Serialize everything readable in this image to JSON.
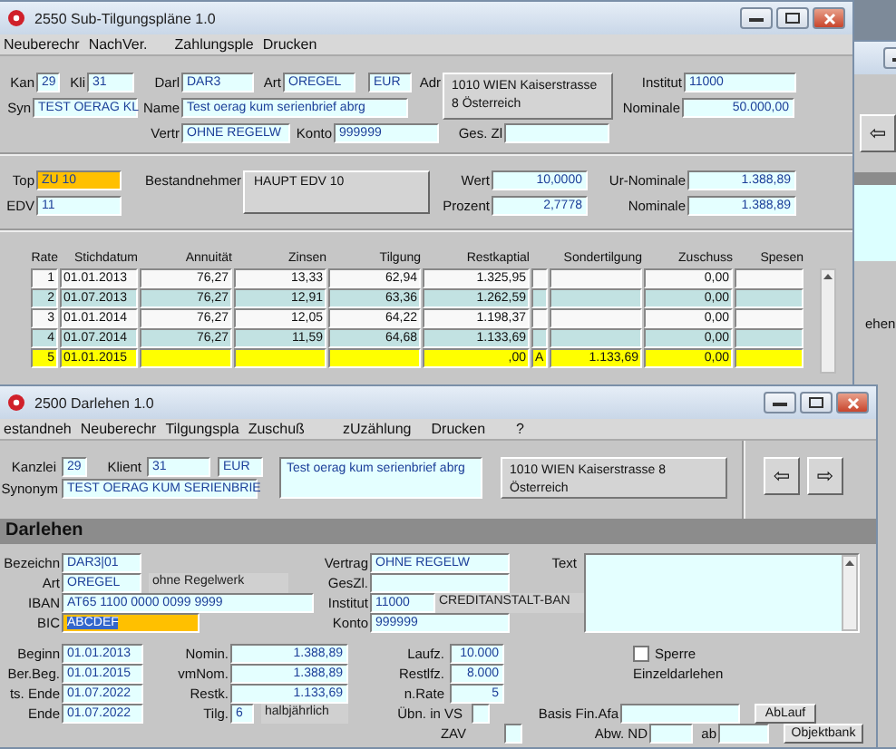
{
  "back_window": {
    "arrow": "⇦",
    "fragment": "ehen"
  },
  "top_window": {
    "title": "2550 Sub-Tilgungspläne 1.0",
    "menu": [
      "Neuberechr",
      "NachVer.",
      "Zahlungsple",
      "Drucken"
    ],
    "kan": {
      "label": "Kan",
      "value": "29"
    },
    "kli": {
      "label": "Kli",
      "value": "31"
    },
    "syn": {
      "label": "Syn",
      "value": "TEST OERAG KL"
    },
    "darl": {
      "label": "Darl",
      "value": "DAR3"
    },
    "art": {
      "label": "Art",
      "value": "OREGEL"
    },
    "currency": "EUR",
    "name": {
      "label": "Name",
      "value": "Test oerag kum serienbrief abrg"
    },
    "vertr": {
      "label": "Vertr",
      "value": "OHNE REGELW"
    },
    "konto": {
      "label": "Konto",
      "value": "999999"
    },
    "adr": {
      "label": "Adr",
      "lines": [
        "1010  WIEN Kaiserstrasse",
        "8 Österreich"
      ]
    },
    "ges_zl": {
      "label": "Ges. Zl"
    },
    "institut": {
      "label": "Institut",
      "value": "11000"
    },
    "nominale": {
      "label": "Nominale",
      "value": "50.000,00"
    },
    "top": {
      "label": "Top",
      "value": "ZU 10",
      "highlighted": true
    },
    "edv": {
      "label": "EDV",
      "value": "11",
      "highlighted": false
    },
    "bestandnehmer": {
      "label": "Bestandnehmer",
      "button": "HAUPT EDV 10"
    },
    "wert": {
      "label": "Wert",
      "value": "10,0000"
    },
    "prozent": {
      "label": "Prozent",
      "value": "2,7778"
    },
    "ur_nominale": {
      "label": "Ur-Nominale",
      "value": "1.388,89"
    },
    "nominale_2": {
      "label": "Nominale",
      "value": "1.388,89"
    },
    "table": {
      "columns": [
        "Rate",
        "Stichdatum",
        "Annuität",
        "Zinsen",
        "Tilgung",
        "Restkaptial",
        "Sondertilgung",
        "Zuschuss",
        "Spesen"
      ],
      "rows": [
        {
          "rate": "1",
          "stichdatum": "01.01.2013",
          "annuitat": "76,27",
          "zinsen": "13,33",
          "tilgung": "62,94",
          "restkaptial": "1.325,95",
          "zuschuss": "0,00",
          "selected": false
        },
        {
          "rate": "2",
          "stichdatum": "01.07.2013",
          "annuitat": "76,27",
          "zinsen": "12,91",
          "tilgung": "63,36",
          "restkaptial": "1.262,59",
          "zuschuss": "0,00",
          "selected": false
        },
        {
          "rate": "3",
          "stichdatum": "01.01.2014",
          "annuitat": "76,27",
          "zinsen": "12,05",
          "tilgung": "64,22",
          "restkaptial": "1.198,37",
          "zuschuss": "0,00",
          "selected": false
        },
        {
          "rate": "4",
          "stichdatum": "01.07.2014",
          "annuitat": "76,27",
          "zinsen": "11,59",
          "tilgung": "64,68",
          "restkaptial": "1.133,69",
          "zuschuss": "0,00",
          "selected": false
        },
        {
          "rate": "5",
          "stichdatum": "01.01.2015",
          "restkaptial": ",00",
          "column_7": "A",
          "sondertilgung": "1.133,69",
          "zuschuss": "0,00",
          "selected": true
        }
      ]
    }
  },
  "bottom_window": {
    "title": "2500 Darlehen 1.0",
    "menu": [
      "estandneh",
      "Neuberechr",
      "Tilgungspla",
      "Zuschuß",
      "zUzählung",
      "Drucken",
      "?"
    ],
    "kanzlei": {
      "label": "Kanzlei",
      "value": "29"
    },
    "klient": {
      "label": "Klient",
      "value": "31"
    },
    "currency": "EUR",
    "synonym": {
      "label": "Synonym",
      "value": "TEST OERAG KUM SERIENBRIE"
    },
    "note": "Test oerag kum serienbrief abrg",
    "address": [
      "1010  WIEN Kaiserstrasse 8",
      "Österreich"
    ],
    "nav": [
      "⇦",
      "⇨"
    ],
    "section": "Darlehen",
    "bezeichn": {
      "label": "Bezeichn",
      "value": "DAR3|01"
    },
    "art": {
      "label": "Art",
      "value": "OREGEL",
      "description": "ohne Regelwerk"
    },
    "iban": {
      "label": "IBAN",
      "value": "AT65 1100 0000 0099 9999"
    },
    "bic": {
      "label": "BIC",
      "value": "ABCDEF",
      "focused": true
    },
    "vertrag": {
      "label": "Vertrag",
      "value": "OHNE REGELW"
    },
    "geszl": {
      "label": "GesZl."
    },
    "institut": {
      "label": "Institut",
      "value": "11000",
      "bank": "CREDITANSTALT-BAN"
    },
    "konto": {
      "label": "Konto",
      "value": "999999"
    },
    "text": {
      "label": "Text"
    },
    "beginn": {
      "label": "Beginn",
      "value": "01.01.2013"
    },
    "ber_beg": {
      "label": "Ber.Beg.",
      "value": "01.01.2015"
    },
    "ts_ende": {
      "label": "ts. Ende",
      "value": "01.07.2022"
    },
    "ende": {
      "label": "Ende",
      "value": "01.07.2022"
    },
    "nomin": {
      "label": "Nomin.",
      "value": "1.388,89"
    },
    "vmnom": {
      "label": "vmNom.",
      "value": "1.388,89"
    },
    "restk": {
      "label": "Restk.",
      "value": "1.133,69"
    },
    "tilg": {
      "label": "Tilg.",
      "value": "6",
      "period": "halbjährlich"
    },
    "laufz": {
      "label": "Laufz.",
      "value": "10.000"
    },
    "restlfz": {
      "label": "Restlfz.",
      "value": "8.000"
    },
    "n_rate": {
      "label": "n.Rate",
      "value": "5"
    },
    "ubn": {
      "label": "Übn. in VS"
    },
    "zav": {
      "label": "ZAV"
    },
    "sperre": {
      "label": "Sperre",
      "checked": false
    },
    "einzeldarlehen": "Einzeldarlehen",
    "basis": {
      "label": "Basis Fin.Afa"
    },
    "abw_nd": {
      "label": "Abw. ND"
    },
    "ab": {
      "label": "ab"
    },
    "buttons": [
      "AbLauf",
      "Objektbank"
    ]
  }
}
